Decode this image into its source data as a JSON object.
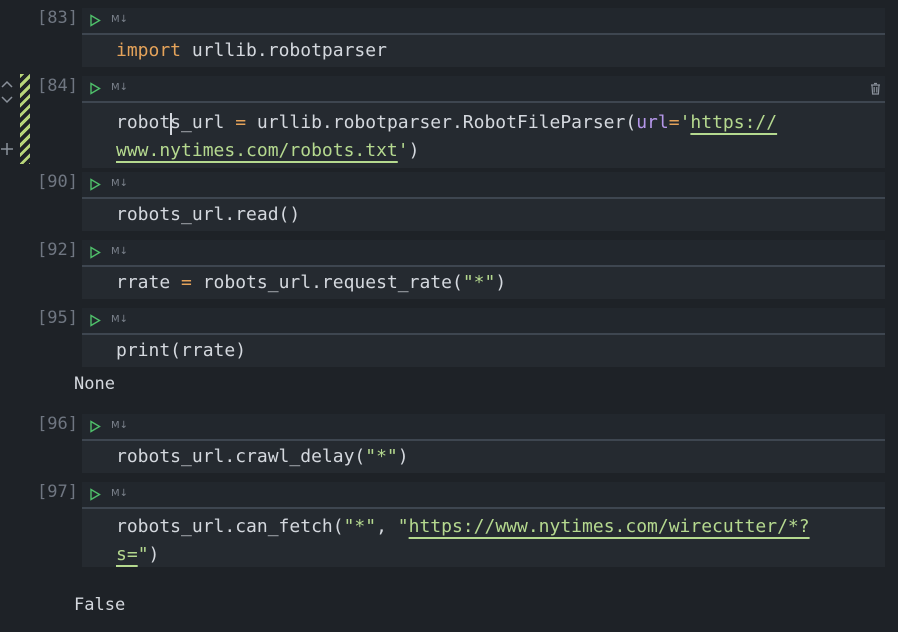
{
  "cells": [
    {
      "exec": "[83]",
      "md": "M↓",
      "line1_kw": "import",
      "line1_rest": " urllib.robotparser"
    },
    {
      "exec": "[84]",
      "md": "M↓",
      "l1_a": "robots_url ",
      "l1_op": "=",
      "l1_b": " urllib.robotparser.RobotFileParser(",
      "l1_param": "url",
      "l1_eq": "=",
      "l1_q": "'",
      "l1_str": "https://",
      "l2_str": "www.nytimes.com/robots.txt",
      "l2_q": "'",
      "l2_end": ")"
    },
    {
      "exec": "[90]",
      "md": "M↓",
      "code": "robots_url.read()"
    },
    {
      "exec": "[92]",
      "md": "M↓",
      "l_a": "rrate ",
      "l_op": "=",
      "l_b": " robots_url.request_rate(",
      "l_str": "\"*\"",
      "l_end": ")"
    },
    {
      "exec": "[95]",
      "md": "M↓",
      "code": "print(rrate)",
      "output": "None"
    },
    {
      "exec": "[96]",
      "md": "M↓",
      "l_a": "robots_url.crawl_delay(",
      "l_str": "\"*\"",
      "l_end": ")"
    },
    {
      "exec": "[97]",
      "md": "M↓",
      "l1_a": "robots_url.can_fetch(",
      "l1_s1": "\"*\"",
      "l1_comma": ", ",
      "l1_q": "\"",
      "l1_link": "https://www.nytimes.com/wirecutter/*?",
      "l2_link": "s=",
      "l2_q": "\"",
      "l2_end": ")",
      "output": "False"
    }
  ],
  "icons": {
    "run": "run-icon",
    "markdown": "markdown-icon",
    "delete": "trash-icon",
    "up": "chevron-up-icon",
    "down": "chevron-down-icon",
    "add": "plus-icon"
  },
  "colors": {
    "keyword": "#e5a35a",
    "string": "#b5d98f",
    "param": "#b597ea",
    "background": "#1e2227"
  }
}
